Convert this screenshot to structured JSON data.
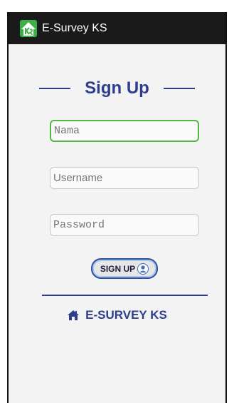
{
  "app": {
    "title": "E-Survey KS"
  },
  "form": {
    "heading": "Sign Up",
    "nama_placeholder": "Nama",
    "username_placeholder": "Username",
    "password_placeholder": "Password",
    "signup_label": "SIGN UP"
  },
  "footer": {
    "brand": "E-SURVEY KS"
  },
  "colors": {
    "accent": "#2e3d8c",
    "focus": "#55b547",
    "actionbar": "#1a1a1a",
    "background": "#f3f3f3"
  },
  "icons": {
    "app": "house-logo-icon",
    "button": "user-icon",
    "footer": "home-icon"
  }
}
